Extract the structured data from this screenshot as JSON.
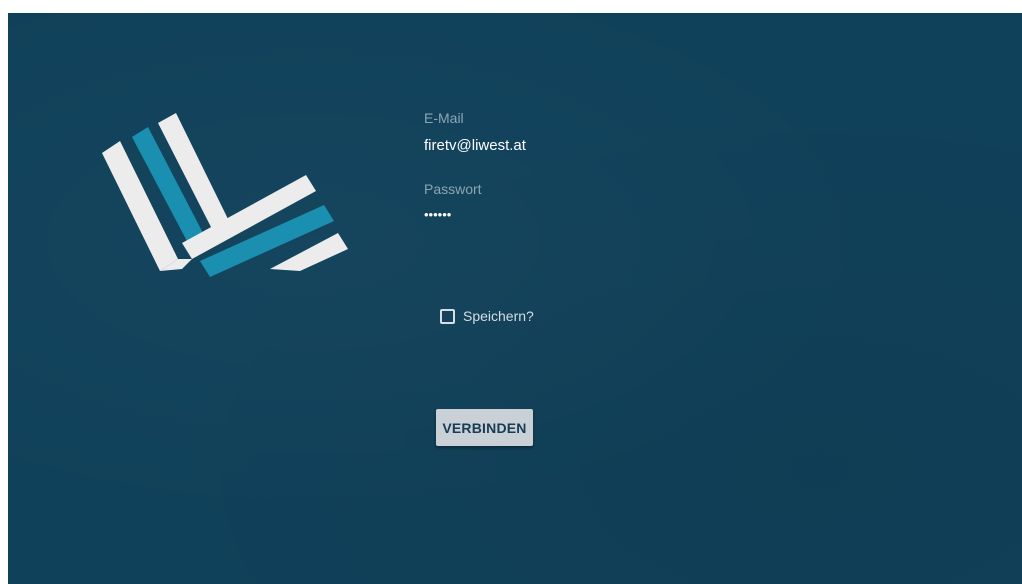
{
  "login": {
    "email_label": "E-Mail",
    "email_value": "firetv@liwest.at",
    "password_label": "Passwort",
    "password_value": "••••••",
    "remember_label": "Speichern?",
    "remember_checked": false,
    "connect_label": "VERBINDEN"
  },
  "colors": {
    "background": "#10415a",
    "logo_white": "#ececec",
    "logo_teal": "#1a8fb0",
    "button_bg": "#c9d1d6",
    "button_text": "#173c53"
  },
  "icons": {
    "logo": "liwest-logo",
    "checkbox": "checkbox-unchecked-icon"
  }
}
